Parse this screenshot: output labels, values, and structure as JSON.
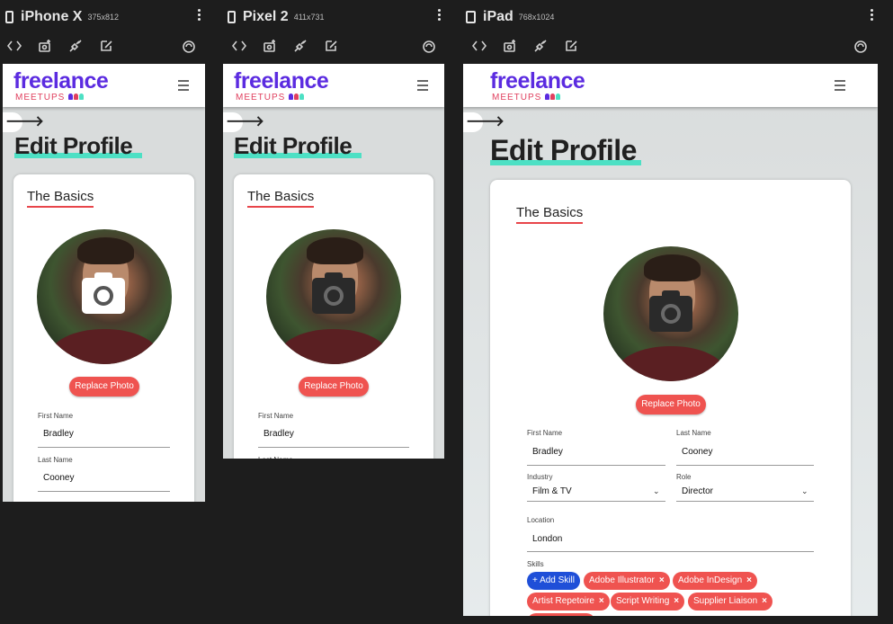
{
  "devices": [
    {
      "name": "iPhone X",
      "size": "375x812"
    },
    {
      "name": "Pixel 2",
      "size": "411x731"
    },
    {
      "name": "iPad",
      "size": "768x1024"
    }
  ],
  "app": {
    "logo_main": "freelance",
    "logo_sub": "MEETUPS",
    "back_glyph": "🡒",
    "page_title": "Edit Profile",
    "section_title": "The Basics",
    "replace_photo": "Replace Photo",
    "colors": {
      "accent": "#5b2be0",
      "brand_pink": "#e0405f",
      "button": "#ef5350",
      "highlight": "#4de0c4",
      "skill_add": "#1f4fd8"
    }
  },
  "form": {
    "first_name_label": "First Name",
    "first_name": "Bradley",
    "last_name_label": "Last Name",
    "last_name": "Cooney",
    "industry_label": "Industry",
    "industry": "Film & TV",
    "role_label": "Role",
    "role": "Director",
    "location_label": "Location",
    "location": "London",
    "skills_label": "Skills",
    "add_skill": "+ Add Skill",
    "skills": [
      "Adobe Illustrator",
      "Adobe InDesign",
      "Artist Repetoire",
      "Script Writing",
      "Supplier Liaison"
    ]
  },
  "icons": {
    "device": "phone-icon",
    "menu": "more-vert-icon",
    "camera": "camera-icon",
    "hamburger": "menu-icon",
    "back": "arrow-right-icon"
  }
}
